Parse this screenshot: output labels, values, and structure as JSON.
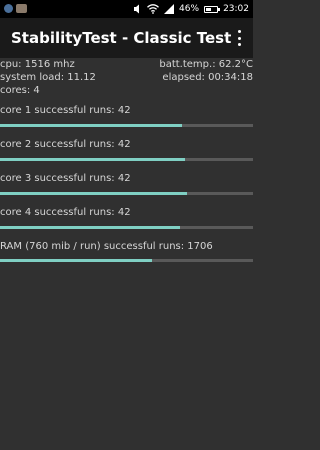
{
  "status_bar": {
    "battery": "46%",
    "battery_level": 0.46,
    "time": "23:02",
    "icons": [
      "app-notification-icon",
      "game-notification-icon",
      "volume-icon",
      "wifi-icon",
      "signal-icon",
      "battery-icon"
    ]
  },
  "header": {
    "title": "StabilityTest - Classic Test",
    "menu_icon": "more-vert-icon"
  },
  "stats": {
    "cpu": "cpu: 1516 mhz",
    "batt_temp": "batt.temp.: 62.2°C",
    "system_load": "system load: 11.12",
    "elapsed": "elapsed: 00:34:18",
    "cores": "cores: 4"
  },
  "rows": [
    {
      "label": "core 1 successful runs: 42",
      "progress": 0.72
    },
    {
      "label": "core 2 successful runs: 42",
      "progress": 0.73
    },
    {
      "label": "core 3 successful runs: 42",
      "progress": 0.74
    },
    {
      "label": "core 4 successful runs: 42",
      "progress": 0.71
    },
    {
      "label": "RAM (760 mib / run) successful runs: 1706",
      "progress": 0.6
    }
  ],
  "colors": {
    "accent": "#7fcfc3",
    "track": "#595959",
    "background": "#303030",
    "app_bar": "#1a1a1a"
  }
}
